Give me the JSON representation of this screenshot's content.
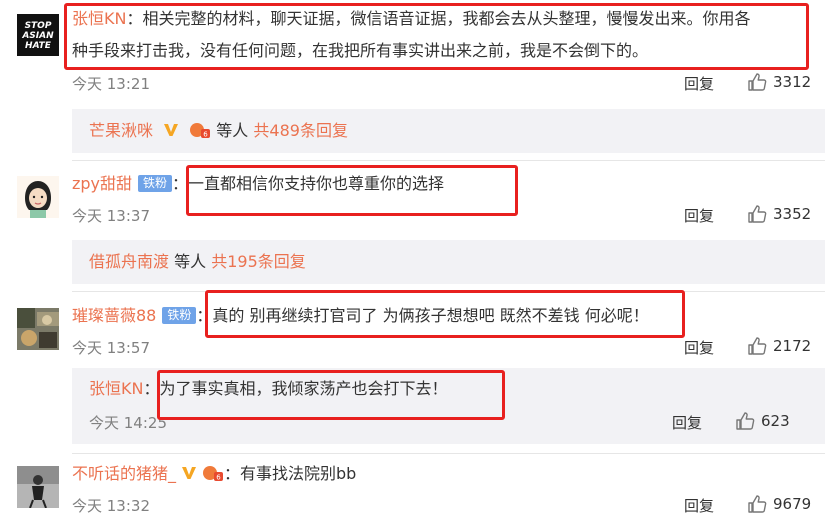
{
  "comments": [
    {
      "user": "张恒KN",
      "text_line1": "：相关完整的材料，聊天证据，微信语音证据，我都会去从头整理，慢慢发出来。你用各",
      "text_line2": "种手段来打击我，没有任何问题，在我把所有事实讲出来之前，我是不会倒下的。",
      "avatar_text": [
        "STOP",
        "ASIAN",
        "HATE"
      ],
      "time": "今天 13:21",
      "reply_label": "回复",
      "likes": "3312",
      "subreply": {
        "user": "芒果湫咪",
        "suffix": "等人",
        "count_text": "共489条回复"
      }
    },
    {
      "user": "zpy甜甜",
      "badge": "铁粉",
      "text": "：一直都相信你支持你也尊重你的选择",
      "time": "今天 13:37",
      "reply_label": "回复",
      "likes": "3352",
      "subreply": {
        "user": "借孤舟南渡",
        "suffix": "等人",
        "count_text": "共195条回复"
      }
    },
    {
      "user": "璀璨蔷薇88",
      "badge": "铁粉",
      "text": "：真的 别再继续打官司了 为俩孩子想想吧 既然不差钱 何必呢！",
      "time": "今天 13:57",
      "reply_label": "回复",
      "likes": "2172",
      "nested": {
        "user": "张恒KN",
        "text": "：为了事实真相，我倾家荡产也会打下去！",
        "time": "今天 14:25",
        "reply_label": "回复",
        "likes": "623"
      }
    },
    {
      "user": "不听话的猪猪_",
      "text": "：有事找法院别bb",
      "time": "今天 13:32",
      "reply_label": "回复",
      "likes": "9679"
    }
  ],
  "colors": {
    "username": "#eb7350",
    "highlight_box": "#e8201f",
    "subreply_bg": "#f2f2f5"
  },
  "icons": [
    "thumbs-up-icon",
    "vip-v-icon",
    "member-level-icon"
  ]
}
